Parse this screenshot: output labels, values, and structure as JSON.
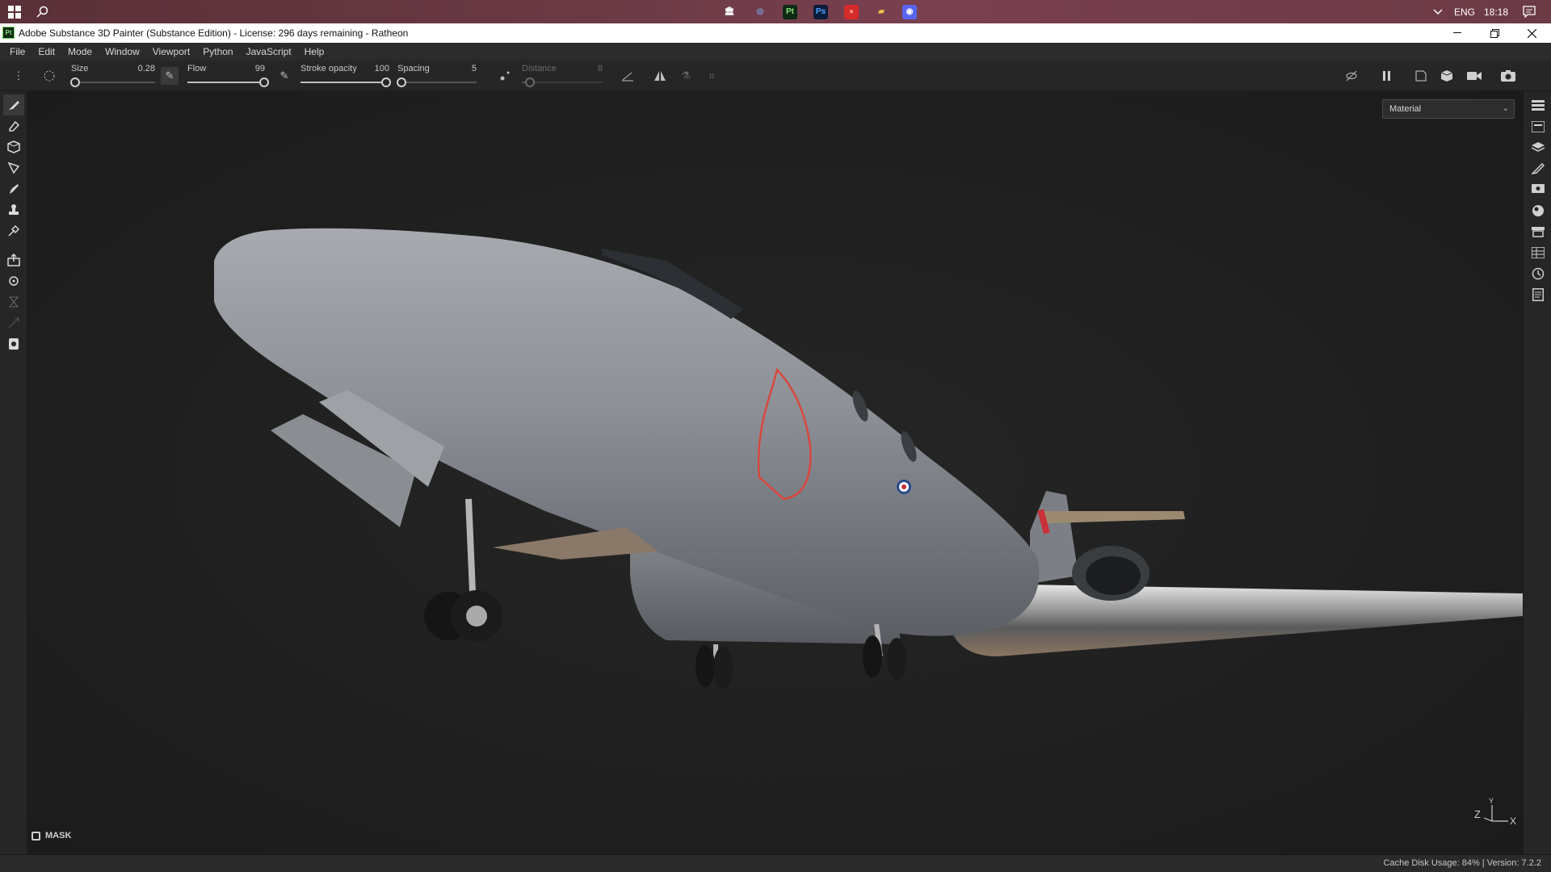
{
  "taskbar": {
    "language": "ENG",
    "time": "18:18",
    "apps": [
      {
        "name": "bank-icon",
        "glyph": "🏛",
        "bg": "transparent",
        "color": "#ffffff"
      },
      {
        "name": "ubisoft-icon",
        "glyph": "◎",
        "bg": "transparent",
        "color": "#7a9fd8"
      },
      {
        "name": "substance-painter-icon",
        "glyph": "Pt",
        "bg": "#0e2a14",
        "color": "#8be07a"
      },
      {
        "name": "photoshop-icon",
        "glyph": "Ps",
        "bg": "#0b1d3a",
        "color": "#4fa3ff"
      },
      {
        "name": "record-icon",
        "glyph": "●",
        "bg": "#d42a2a",
        "color": "#ff8a8a"
      },
      {
        "name": "file-explorer-icon",
        "glyph": "▰",
        "bg": "transparent",
        "color": "#f3c64b"
      },
      {
        "name": "discord-icon",
        "glyph": "◉",
        "bg": "#5865f2",
        "color": "#ffffff"
      }
    ]
  },
  "window": {
    "title": "Adobe Substance 3D Painter (Substance Edition) - License: 296 days remaining - Ratheon",
    "logo": "Pt"
  },
  "menu": [
    "File",
    "Edit",
    "Mode",
    "Window",
    "Viewport",
    "Python",
    "JavaScript",
    "Help"
  ],
  "tool_properties": {
    "size": {
      "label": "Size",
      "value": "0.28",
      "fraction": 0.05
    },
    "flow": {
      "label": "Flow",
      "value": "99",
      "fraction": 0.99
    },
    "stroke_opacity": {
      "label": "Stroke opacity",
      "value": "100",
      "fraction": 1.0
    },
    "spacing": {
      "label": "Spacing",
      "value": "5",
      "fraction": 0.05
    },
    "distance": {
      "label": "Distance",
      "value": "8",
      "fraction": 0.1,
      "enabled": false
    }
  },
  "viewport": {
    "material_select": "Material",
    "mask_label": "MASK",
    "gizmo": {
      "z": "Z",
      "y": "Y",
      "x": "X"
    }
  },
  "statusbar": {
    "text": "Cache Disk Usage:   84% | Version: 7.2.2"
  },
  "colors": {
    "fuselage": "#8c9096",
    "roundel_red": "#c8303a",
    "roundel_blue": "#2a4a8a",
    "outline_red": "#d8473d"
  }
}
